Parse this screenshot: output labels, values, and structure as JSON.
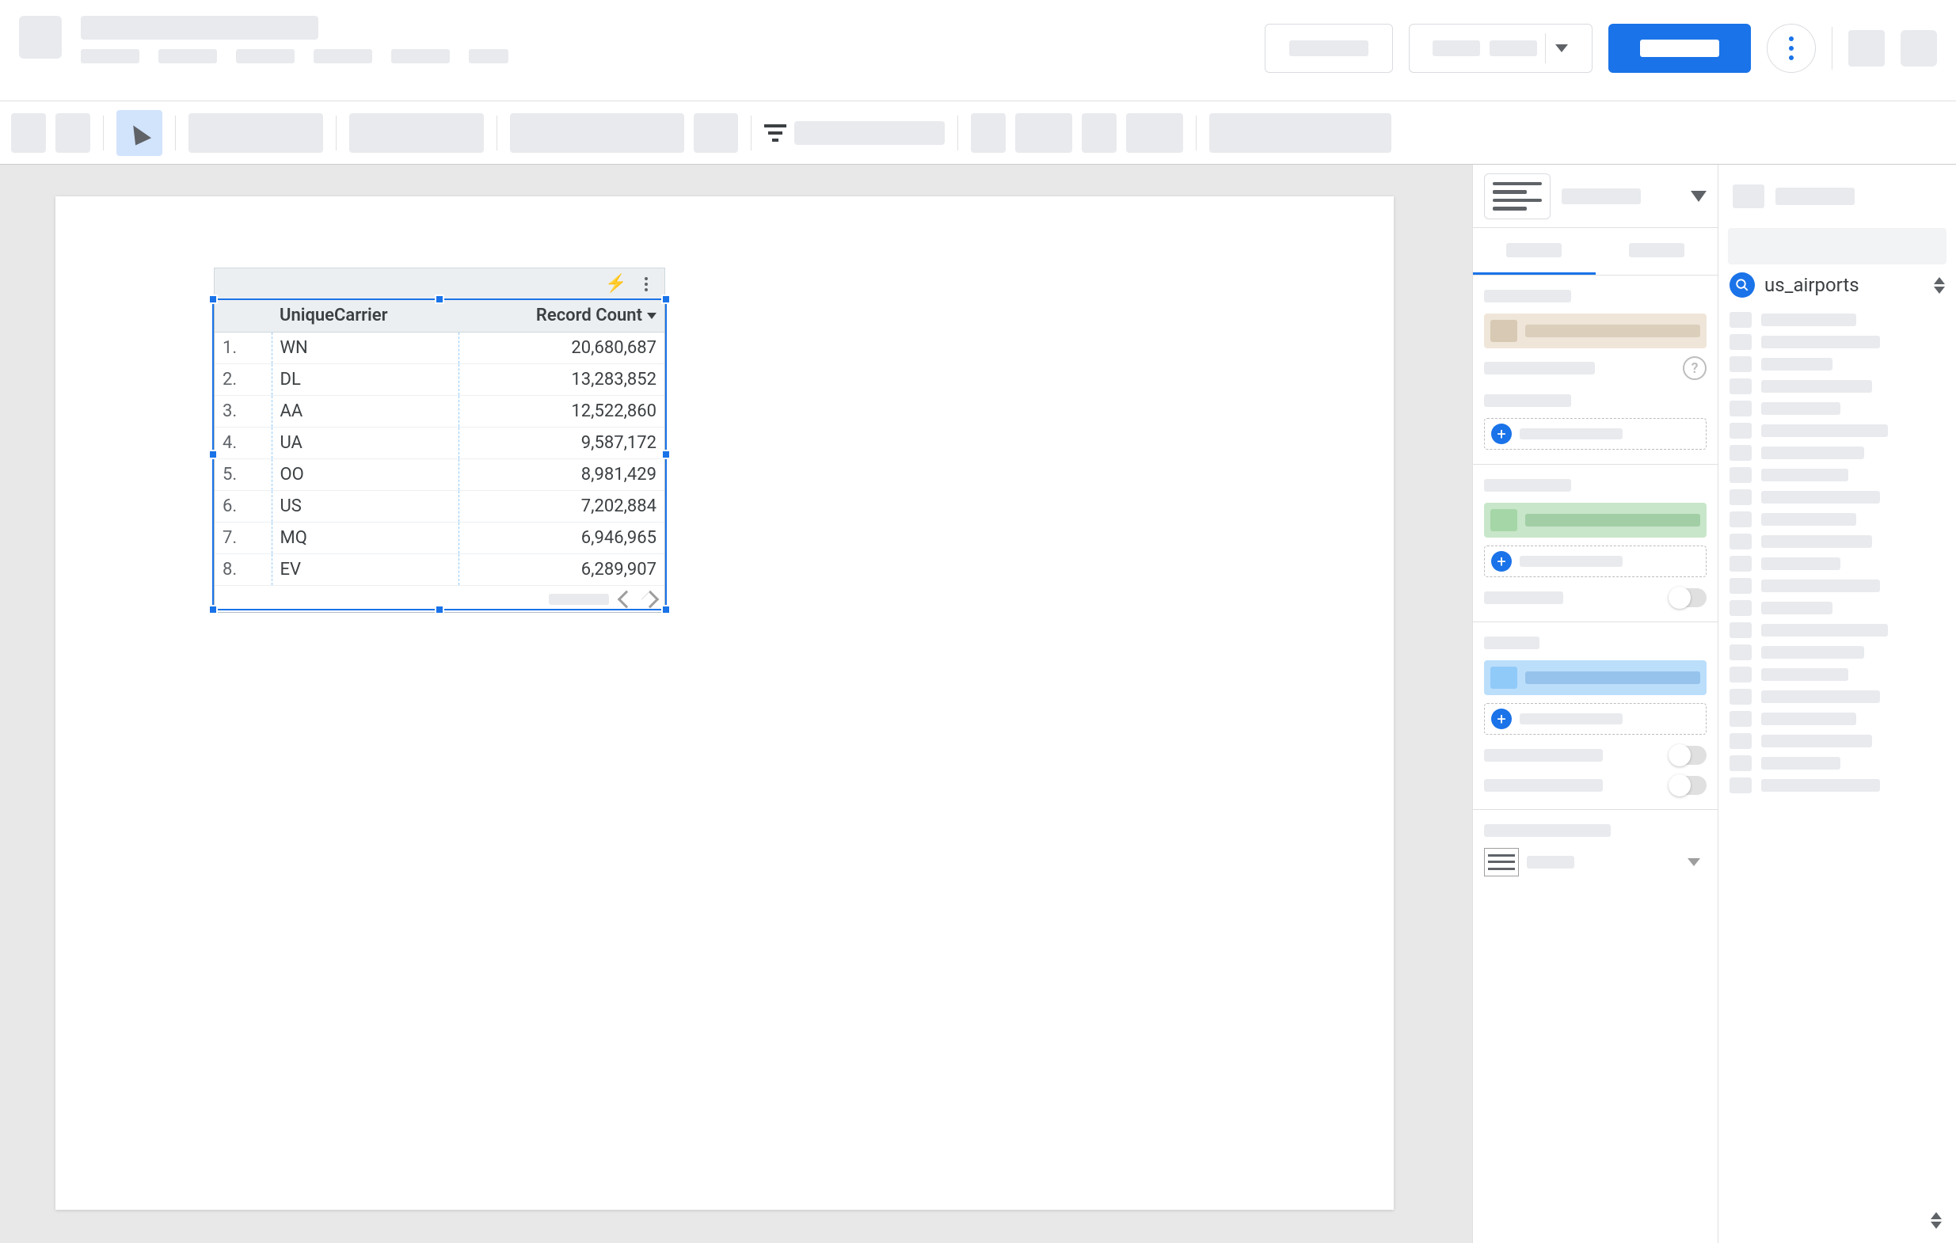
{
  "table": {
    "headers": {
      "dim": "UniqueCarrier",
      "metric": "Record Count"
    },
    "rows": [
      {
        "idx": "1.",
        "carrier": "WN",
        "count": "20,680,687"
      },
      {
        "idx": "2.",
        "carrier": "DL",
        "count": "13,283,852"
      },
      {
        "idx": "3.",
        "carrier": "AA",
        "count": "12,522,860"
      },
      {
        "idx": "4.",
        "carrier": "UA",
        "count": "9,587,172"
      },
      {
        "idx": "5.",
        "carrier": "OO",
        "count": "8,981,429"
      },
      {
        "idx": "6.",
        "carrier": "US",
        "count": "7,202,884"
      },
      {
        "idx": "7.",
        "carrier": "MQ",
        "count": "6,946,965"
      },
      {
        "idx": "8.",
        "carrier": "EV",
        "count": "6,289,907"
      }
    ]
  },
  "data_panel": {
    "source_name": "us_airports"
  },
  "chart_data": {
    "type": "table",
    "columns": [
      "UniqueCarrier",
      "Record Count"
    ],
    "sort": {
      "column": "Record Count",
      "direction": "desc"
    },
    "rows": [
      [
        "WN",
        20680687
      ],
      [
        "DL",
        13283852
      ],
      [
        "AA",
        12522860
      ],
      [
        "UA",
        9587172
      ],
      [
        "OO",
        8981429
      ],
      [
        "US",
        7202884
      ],
      [
        "MQ",
        6946965
      ],
      [
        "EV",
        6289907
      ]
    ]
  }
}
